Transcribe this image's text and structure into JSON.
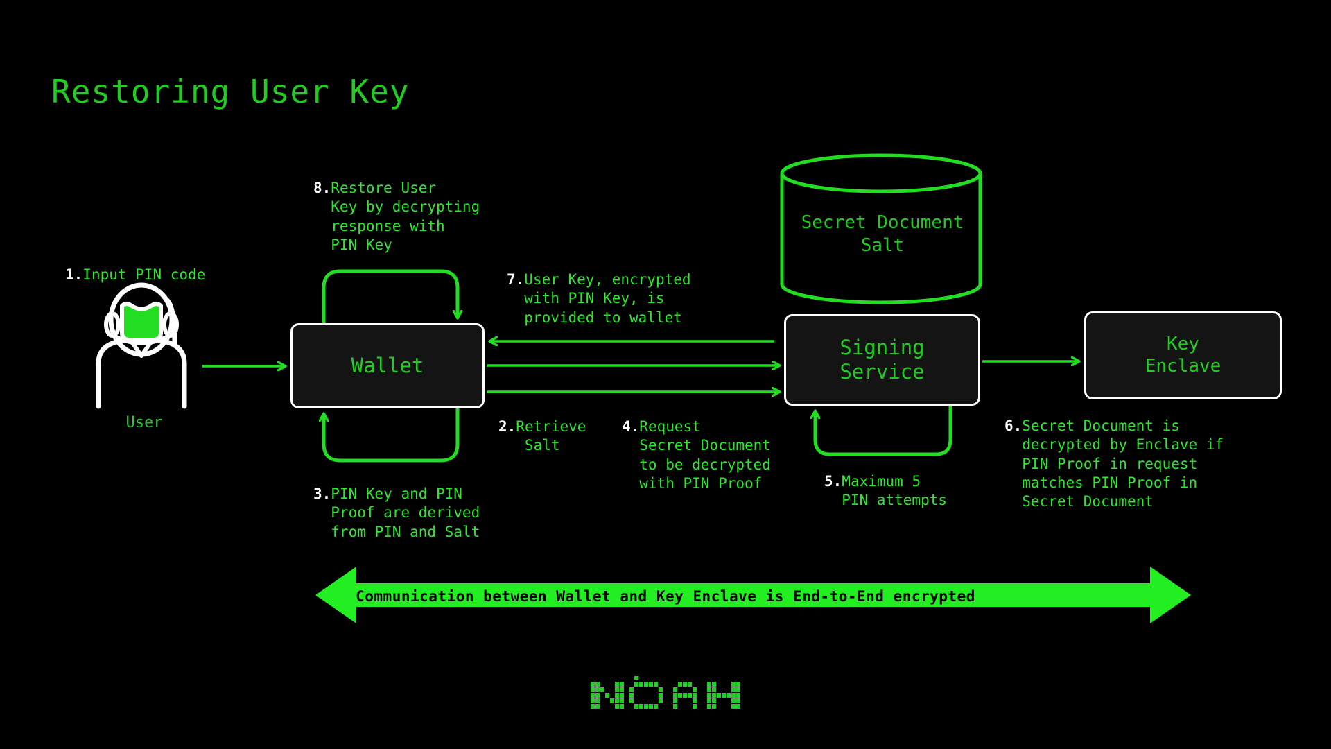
{
  "title": "Restoring User Key",
  "colors": {
    "background": "#000000",
    "accent_green": "#22cc22",
    "bright_green": "#2ee62e",
    "banner_green": "#22ee22",
    "node_border": "#ffffff",
    "node_fill": "#141414",
    "step_number": "#ffffff",
    "banner_text": "#000000"
  },
  "nodes": {
    "user": {
      "label": "User",
      "icon": "astronaut-icon"
    },
    "wallet": {
      "label": "Wallet"
    },
    "signing_service": {
      "label": "Signing\nService"
    },
    "key_enclave": {
      "label": "Key\nEnclave"
    },
    "database": {
      "label": "Secret Document\nSalt",
      "shape": "cylinder"
    }
  },
  "steps": [
    {
      "num": "1.",
      "lines": [
        "Input PIN code"
      ]
    },
    {
      "num": "2.",
      "lines": [
        "Retrieve",
        " Salt"
      ]
    },
    {
      "num": "3.",
      "lines": [
        "PIN Key and PIN",
        "Proof are derived",
        "from PIN and Salt"
      ]
    },
    {
      "num": "4.",
      "lines": [
        "Request",
        "Secret Document",
        "to be decrypted",
        "with PIN Proof"
      ]
    },
    {
      "num": "5.",
      "lines": [
        "Maximum 5",
        "PIN attempts"
      ]
    },
    {
      "num": "6.",
      "lines": [
        "Secret Document is",
        "decrypted by Enclave if",
        "PIN Proof in request",
        "matches PIN Proof in",
        "Secret Document"
      ]
    },
    {
      "num": "7.",
      "lines": [
        "User Key, encrypted",
        "with PIN Key, is",
        "provided to wallet"
      ]
    },
    {
      "num": "8.",
      "lines": [
        "Restore User",
        "Key by decrypting",
        "response with",
        "PIN Key"
      ]
    }
  ],
  "banner": {
    "text": "Communication between Wallet and Key Enclave is End-to-End encrypted",
    "icon_left": "arrow-left-icon",
    "icon_right": "arrow-right-icon"
  },
  "logo": {
    "text": "NOAH",
    "style": "dot-matrix"
  }
}
